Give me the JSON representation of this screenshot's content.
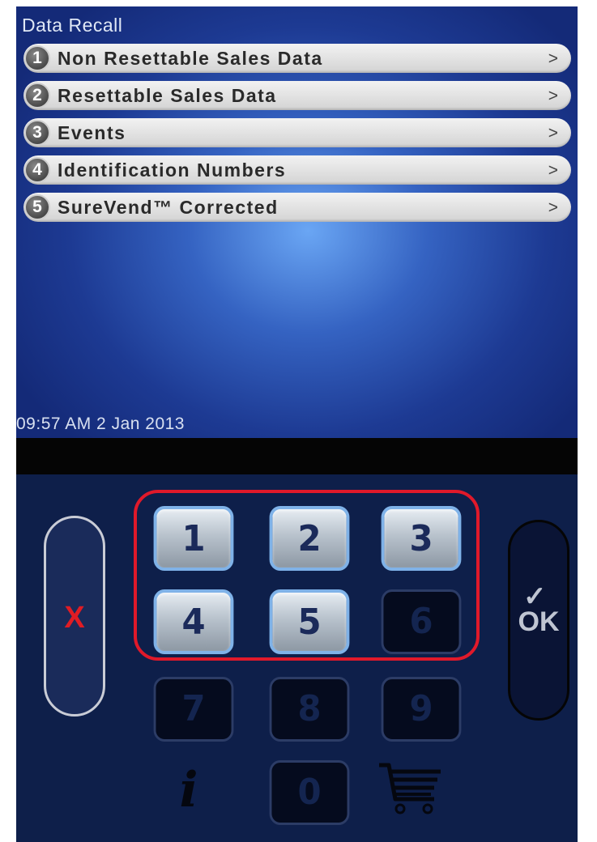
{
  "screen": {
    "title": "Data Recall",
    "menu": [
      {
        "num": "1",
        "label": "Non Resettable Sales Data",
        "arrow": ">"
      },
      {
        "num": "2",
        "label": "Resettable Sales Data",
        "arrow": ">"
      },
      {
        "num": "3",
        "label": "Events",
        "arrow": ">"
      },
      {
        "num": "4",
        "label": "Identification Numbers",
        "arrow": ">"
      },
      {
        "num": "5",
        "label": "SureVend™ Corrected",
        "arrow": ">"
      }
    ],
    "datetime": "09:57 AM 2 Jan 2013"
  },
  "keypad": {
    "keys": [
      "1",
      "2",
      "3",
      "4",
      "5",
      "6",
      "7",
      "8",
      "9",
      "0"
    ],
    "active_keys": [
      "1",
      "2",
      "3",
      "4",
      "5"
    ],
    "cancel_label": "X",
    "ok_label": "OK",
    "ok_check": "✓",
    "info_label": "i",
    "info_icon": "info-icon",
    "cart_icon": "cart-icon",
    "highlight_color": "#e0192a"
  }
}
